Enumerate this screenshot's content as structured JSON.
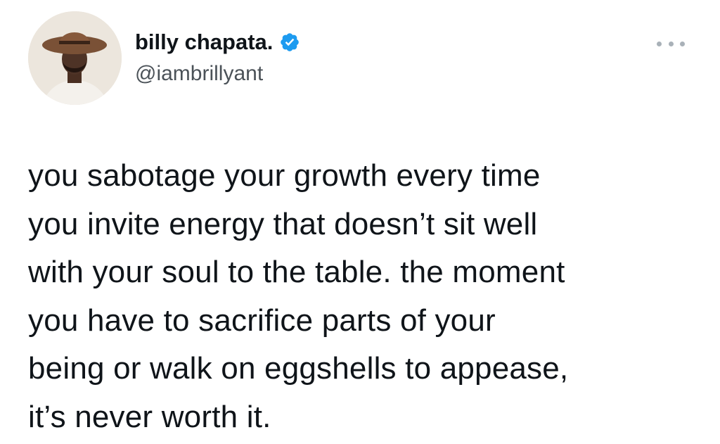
{
  "author": {
    "display_name": "billy chapata.",
    "handle": "@iambrillyant",
    "verified": true,
    "verified_color": "#1d9bf0"
  },
  "avatar": {
    "icon": "profile-photo-man-in-hat"
  },
  "more_icon": "more-dots-icon",
  "tweet": {
    "lines": [
      "you sabotage your growth every time",
      "you invite energy that doesn’t sit well",
      "with your soul to the table. the moment",
      "you have to sacrifice parts of your",
      "being or walk on eggshells to appease,",
      "it’s never worth it."
    ]
  }
}
